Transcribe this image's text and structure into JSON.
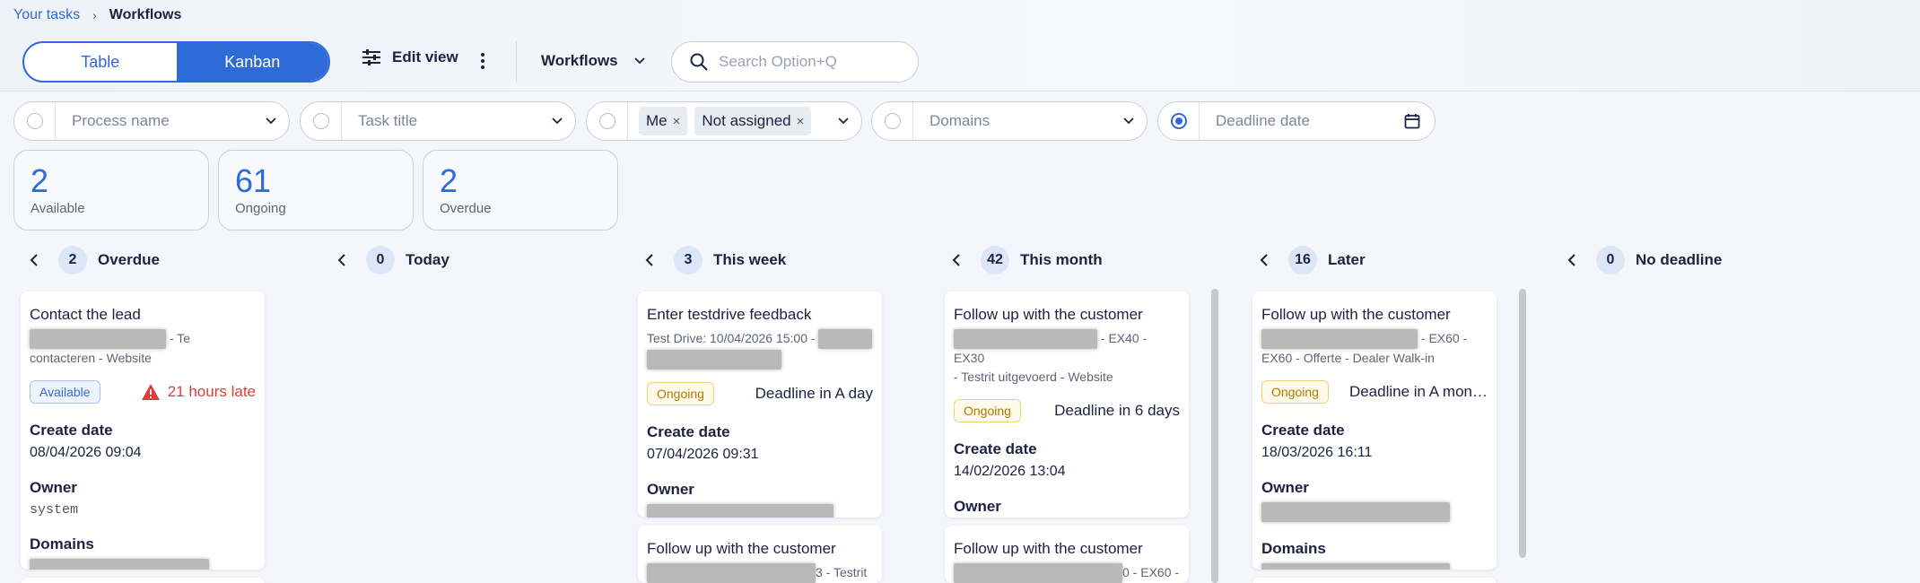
{
  "breadcrumb": {
    "parent": "Your tasks",
    "current": "Workflows"
  },
  "toolbar": {
    "view_table": "Table",
    "view_kanban": "Kanban",
    "edit_view": "Edit view",
    "workflows": "Workflows",
    "search_placeholder": "Search Option+Q"
  },
  "filters": {
    "process_name": "Process name",
    "task_title": "Task title",
    "assignee_chips": [
      "Me",
      "Not assigned"
    ],
    "domains": "Domains",
    "deadline_date": "Deadline date"
  },
  "stats": [
    {
      "value": "2",
      "label": "Available"
    },
    {
      "value": "61",
      "label": "Ongoing"
    },
    {
      "value": "2",
      "label": "Overdue"
    }
  ],
  "columns": [
    {
      "count": "2",
      "title": "Overdue"
    },
    {
      "count": "0",
      "title": "Today"
    },
    {
      "count": "3",
      "title": "This week"
    },
    {
      "count": "42",
      "title": "This month"
    },
    {
      "count": "16",
      "title": "Later"
    },
    {
      "count": "0",
      "title": "No deadline"
    }
  ],
  "cards": {
    "overdue_1": {
      "title": "Contact the lead",
      "sub_a": " - Te",
      "sub_b": "contacteren - Website",
      "badge": "Available",
      "late": "21 hours late",
      "create_label": "Create date",
      "create_value": "08/04/2026 09:04",
      "owner_label": "Owner",
      "owner_value": "system",
      "domains_label": "Domains"
    },
    "week_1": {
      "title": "Enter testdrive feedback",
      "sub_a": "Test Drive: 10/04/2026 15:00 - ",
      "badge": "Ongoing",
      "deadline": "Deadline in A day",
      "create_label": "Create date",
      "create_value": "07/04/2026 09:31",
      "owner_label": "Owner"
    },
    "week_2": {
      "title": "Follow up with the customer",
      "sub_a": "3 - Testrit"
    },
    "month_1": {
      "title": "Follow up with the customer",
      "sub_a": " - EX40 - EX30",
      "sub_b": "- Testrit uitgevoerd - Website",
      "badge": "Ongoing",
      "deadline": "Deadline in 6 days",
      "create_label": "Create date",
      "create_value": "14/02/2026 13:04",
      "owner_label": "Owner"
    },
    "month_2": {
      "title": "Follow up with the customer",
      "sub_a": "0 - EX60 -"
    },
    "later_1": {
      "title": "Follow up with the customer",
      "sub_a": " - EX60 -",
      "sub_b": "EX60 - Offerte - Dealer Walk-in",
      "badge": "Ongoing",
      "deadline": "Deadline in A mon…",
      "create_label": "Create date",
      "create_value": "18/03/2026 16:11",
      "owner_label": "Owner",
      "domains_label": "Domains"
    }
  },
  "colors": {
    "accent": "#2f6bd8",
    "late": "#e03b3b",
    "ongoing": "#b07800"
  }
}
